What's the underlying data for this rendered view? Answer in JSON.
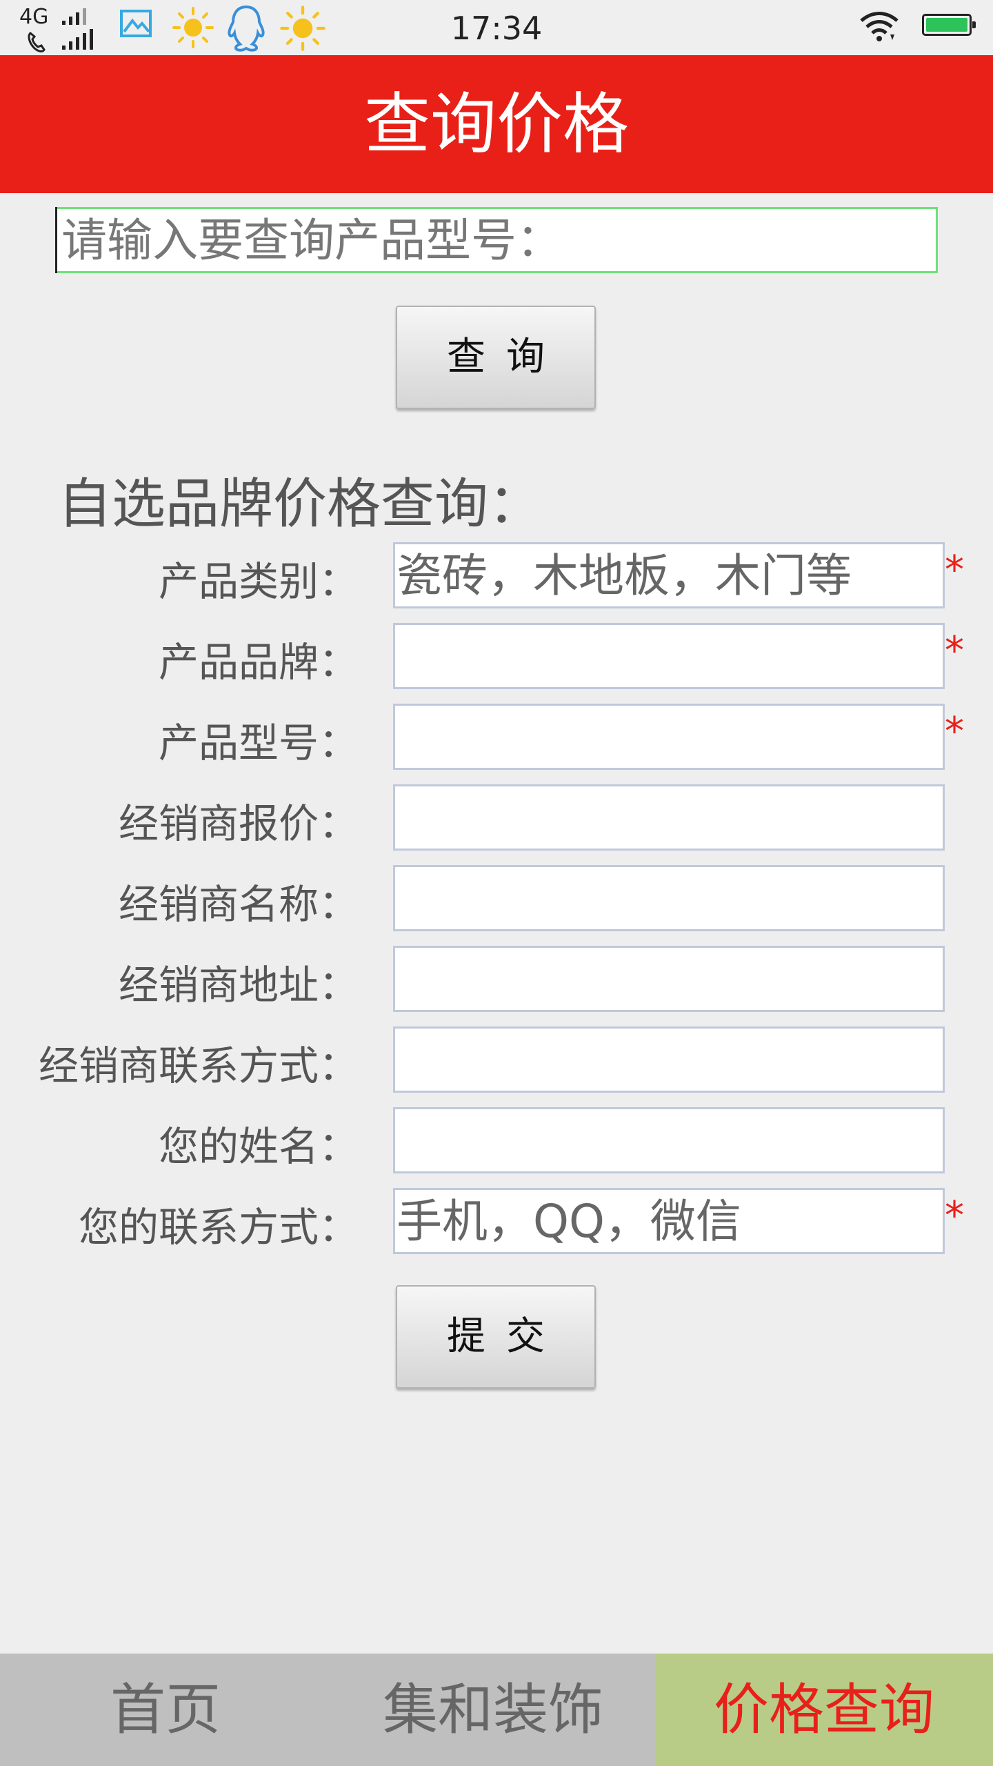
{
  "status_bar": {
    "network": "4G",
    "time": "17:34",
    "icons": [
      "signal-icon",
      "call-signal-icon",
      "gallery-icon",
      "sun-icon",
      "qq-icon",
      "sun-icon",
      "wifi-icon",
      "battery-icon"
    ]
  },
  "header": {
    "title": "查询价格"
  },
  "search": {
    "placeholder": "请输入要查询产品型号：",
    "button_label": "查询"
  },
  "form": {
    "heading": "自选品牌价格查询：",
    "fields": [
      {
        "label": "产品类别：",
        "placeholder": "瓷砖，木地板，木门等",
        "required": true
      },
      {
        "label": "产品品牌：",
        "placeholder": "",
        "required": true
      },
      {
        "label": "产品型号：",
        "placeholder": "",
        "required": true
      },
      {
        "label": "经销商报价：",
        "placeholder": "",
        "required": false
      },
      {
        "label": "经销商名称：",
        "placeholder": "",
        "required": false
      },
      {
        "label": "经销商地址：",
        "placeholder": "",
        "required": false
      },
      {
        "label": "经销商联系方式：",
        "placeholder": "",
        "required": false
      },
      {
        "label": "您的姓名：",
        "placeholder": "",
        "required": false
      },
      {
        "label": "您的联系方式：",
        "placeholder": "手机，QQ，微信",
        "required": true
      }
    ],
    "required_mark": "*",
    "submit_label": "提交"
  },
  "bottom_nav": {
    "tabs": [
      {
        "label": "首页",
        "active": false
      },
      {
        "label": "集和装饰",
        "active": false
      },
      {
        "label": "价格查询",
        "active": true
      }
    ]
  },
  "colors": {
    "header_bg": "#e82017",
    "active_tab_bg": "#b8cc88",
    "active_tab_text": "#e8201a",
    "nav_bg": "#bfbfbf",
    "search_border": "#6ee279",
    "field_border": "#bfc9db",
    "required_mark": "#e8201a"
  }
}
